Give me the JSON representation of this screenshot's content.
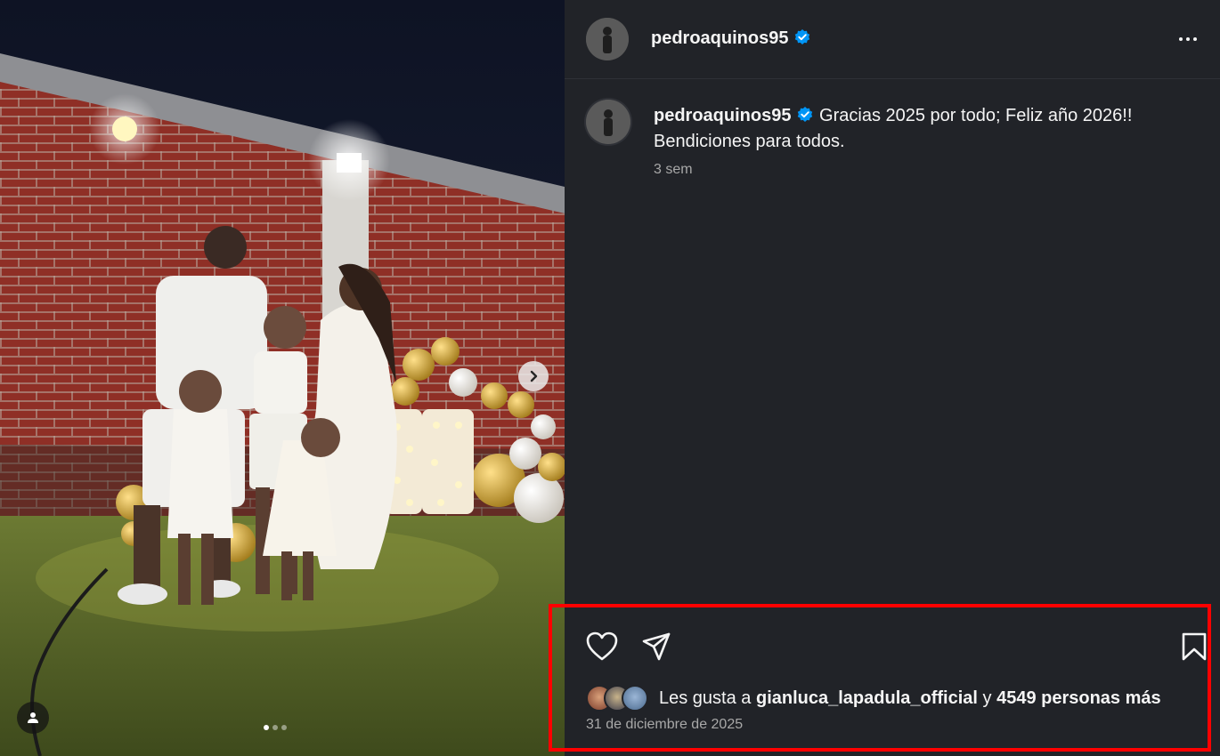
{
  "post": {
    "username": "pedroaquinos95",
    "caption": "Gracias 2025 por todo; Feliz año 2026!! Bendiciones para todos.",
    "caption_time": "3 sem",
    "likes": {
      "prefix": "Les gusta a",
      "user": "gianluca_lapadula_official",
      "connector": "y",
      "others": "4549 personas más"
    },
    "date": "31 de diciembre de 2025"
  },
  "carousel": {
    "slides": 3,
    "active": 1
  },
  "icons": {
    "verified": "verified-badge-icon",
    "more": "more-options-icon",
    "like": "heart-icon",
    "share": "paper-plane-icon",
    "save": "bookmark-icon",
    "next": "chevron-right-icon",
    "tag": "user-tag-icon"
  },
  "colors": {
    "panel_bg": "#212328",
    "verified": "#0095f6",
    "highlight": "#ff0000",
    "muted_text": "#a8a8a8"
  }
}
